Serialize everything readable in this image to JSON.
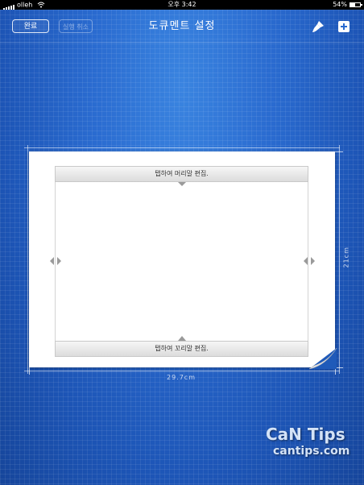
{
  "status_bar": {
    "carrier": "olleh",
    "time": "오후 3:42",
    "battery": "54%"
  },
  "toolbar": {
    "done_label": "완료",
    "undo_label": "실행 취소",
    "title": "도큐멘트 설정",
    "brush_icon": "paintbrush-icon",
    "add_icon": "add-page-icon"
  },
  "document": {
    "header_placeholder": "탭하여 머리말 편집.",
    "footer_placeholder": "탭하여 꼬리말 편집.",
    "width_label": "29.7cm",
    "height_label": "21cm"
  },
  "watermark": {
    "line1": "CaN Tips",
    "line2": "cantips.com"
  },
  "colors": {
    "background": "#2a6bd0",
    "page": "#ffffff"
  }
}
